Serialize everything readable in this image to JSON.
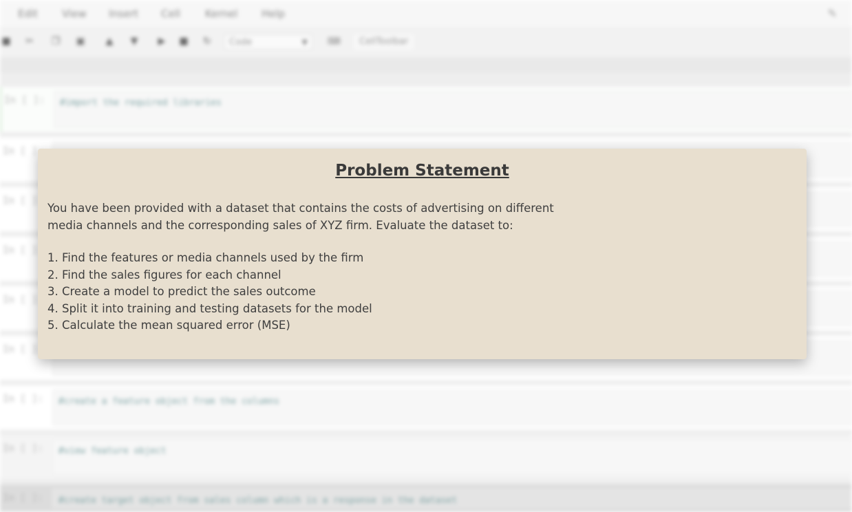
{
  "notebook": {
    "menu": [
      "Edit",
      "View",
      "Insert",
      "Cell",
      "Kernel",
      "Help"
    ],
    "toolbar": {
      "cell_type": "Code",
      "celltoolbar_label": "CellToolbar"
    },
    "cells": [
      {
        "prompt": "In [ ]:",
        "code": "#import the required libraries",
        "active": true
      },
      {
        "prompt": "In [ ]:",
        "code": ""
      },
      {
        "prompt": "In [ ]:",
        "code": ""
      },
      {
        "prompt": "In [ ]:",
        "code": ""
      },
      {
        "prompt": "In [ ]:",
        "code": ""
      },
      {
        "prompt": "In [ ]:",
        "code": ""
      },
      {
        "prompt": "In [ ]:",
        "code": "#create a feature object from the columns"
      },
      {
        "prompt": "In [ ]:",
        "code": "#view feature object"
      },
      {
        "prompt": "In [ ]:",
        "code": "#create target object from sales column which is a response in the dataset"
      }
    ]
  },
  "card": {
    "title": "Problem Statement",
    "intro_line1": "You have been provided with a dataset that contains the costs of advertising on different",
    "intro_line2": "media channels and the corresponding sales of XYZ firm. Evaluate the dataset to:",
    "items": [
      "1. Find the features or media channels used by the firm",
      "2. Find the sales figures for each channel",
      "3. Create a model to predict the sales outcome",
      "4. Split it into training and testing datasets for the model",
      "5. Calculate the mean squared error (MSE)"
    ]
  },
  "colors": {
    "card_background": "#e8dfcf",
    "card_text": "#3d3d3d",
    "comment_text": "#7fa4a5"
  }
}
